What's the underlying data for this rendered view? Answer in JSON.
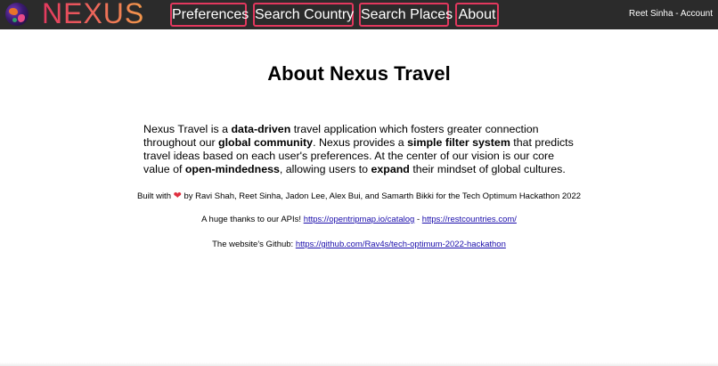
{
  "navbar": {
    "logo_icon": "globe-icon",
    "logo_text": "NEXUS",
    "items": [
      {
        "label": "Preferences"
      },
      {
        "label": "Search Country"
      },
      {
        "label": "Search Places"
      },
      {
        "label": "About"
      }
    ],
    "account_text": "Reet Sinha - Account",
    "colors": {
      "background": "#2b2b2b",
      "accent": "#e2385e"
    }
  },
  "main": {
    "title": "About Nexus Travel",
    "description": {
      "t1": "Nexus Travel is a ",
      "b1": "data-driven",
      "t2": " travel application which fosters greater connection throughout our ",
      "b2": "global community",
      "t3": ". Nexus provides a ",
      "b3": "simple filter system",
      "t4": " that predicts travel ideas based on each user's preferences. At the center of our vision is our core value of ",
      "b4": "open-mindedness",
      "t5": ", allowing users to ",
      "b5": "expand",
      "t6": " their mindset of global cultures."
    },
    "built_with": {
      "prefix": "Built with",
      "heart_icon": "heart-icon",
      "suffix": "by Ravi Shah, Reet Sinha, Jadon Lee, Alex Bui, and Samarth Bikki for the Tech Optimum Hackathon 2022"
    },
    "apis": {
      "prefix": "A huge thanks to our APIs!",
      "link1": "https://opentripmap.io/catalog",
      "separator": "-",
      "link2": "https://restcountries.com/"
    },
    "github": {
      "prefix": "The website's Github:",
      "link": "https://github.com/Rav4s/tech-optimum-2022-hackathon"
    }
  }
}
